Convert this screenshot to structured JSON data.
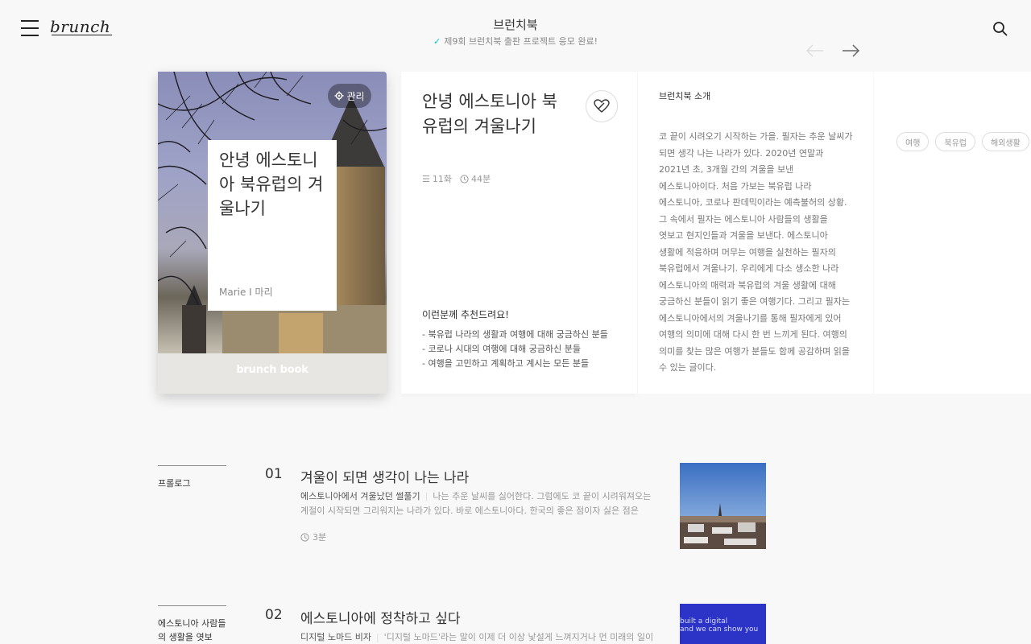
{
  "header": {
    "logo": "brunch",
    "title": "브런치북",
    "subtitle": "제9회 브런치북 출판 프로젝트 응모 완료!"
  },
  "cover": {
    "manage_label": "관리",
    "title": "안녕 에스토니아 북유럽의 겨울나기",
    "author": "Marie I 마리",
    "brand": "brunch book"
  },
  "info": {
    "title": "안녕 에스토니아 북유럽의 겨울나기",
    "episodes": "11화",
    "read_time": "44분",
    "recommend_heading": "이런분께 추천드려요!",
    "recommend": [
      "- 북유럽 나라의 생활과 여행에 대해 궁금하신 분들",
      "- 코로나 시대의 여행에 대해 궁금하신 분들",
      "- 여행을 고민하고 계획하고 계시는 모든 분들"
    ]
  },
  "intro": {
    "heading": "브런치북 소개",
    "body": "코 끝이 시려오기 시작하는 가을. 필자는 추운 날씨가 되면 생각 나는 나라가 있다. 2020년 연말과 2021년 초, 3개월 간의 겨울을 보낸 에스토니아이다. 처음 가보는 북유럽 나라 에스토니아, 코로나 판데믹이라는 예측불허의 상황. 그 속에서 필자는 에스토니아 사람들의 생활을 엿보고 현지인들과 겨울을 보낸다. 에스토니아 생활에 적응하며 머무는 여행을 실천하는 필자의 북유럽에서 겨울나기. 우리에게 다소 생소한 나라 에스토니아의 매력과 북유럽의 겨울 생활에 대해 궁금하신 분들이 읽기 좋은 여행기다. 그리고 필자는 에스토니아에서의 겨울나기를 통해 필자에게 있어 여행의 의미에 대해 다시 한 번 느끼게 된다. 여행의 의미를 찾는 많은 여행가 분들도 함께 공감하며 읽을 수 있는 글이다."
  },
  "tags": [
    "여행",
    "북유럽",
    "해외생활"
  ],
  "articles": [
    {
      "section": "프롤로그",
      "num": "01",
      "title": "겨울이 되면 생각이 나는 나라",
      "subtitle": "에스토니아에서 겨울났던 썰풀기",
      "excerpt": "나는 추운 날씨를 싫어한다. 그럼에도 코 끝이 시려워져오는 계절이 시작되면 그리워지는 나라가 있다. 바로 에스토니아다. 한국의 좋은 점이자 싫은 점은 사…",
      "time": "3분"
    },
    {
      "section": "에스토니아 사람들의 생활을 엿보",
      "num": "02",
      "title": "에스토니아에 정착하고 싶다",
      "subtitle": "디지털 노마드 비자",
      "excerpt": "'디지털 노마드'라는 말이 이제 더 이상 낯설게 느껴지거나 먼 미래의 일이",
      "time": "",
      "thumb_text": "built a digital\nand we can show you"
    }
  ],
  "colors": {
    "accent": "#00c3bd",
    "text": "#333333",
    "muted": "#999999",
    "background": "#f8f8f8"
  }
}
